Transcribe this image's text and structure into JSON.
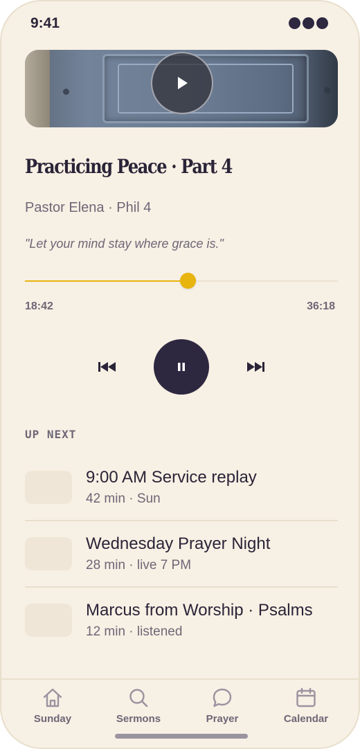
{
  "status_bar": {
    "time": "9:41"
  },
  "now_playing": {
    "title": "Practicing Peace · Part 4",
    "subtitle": "Pastor Elena · Phil 4",
    "quote": "\"Let your mind stay where grace is.\"",
    "elapsed": "18:42",
    "duration": "36:18",
    "progress_fraction": 0.52
  },
  "controls": {
    "prev_icon": "skip-back-icon",
    "pause_icon": "pause-icon",
    "next_icon": "skip-forward-icon"
  },
  "up_next": {
    "label": "UP NEXT",
    "items": [
      {
        "title": "9:00 AM Service replay",
        "meta": "42 min · Sun"
      },
      {
        "title": "Wednesday Prayer Night",
        "meta": "28 min · live 7 PM"
      },
      {
        "title": "Marcus from Worship · Psalms",
        "meta": "12 min · listened"
      }
    ]
  },
  "tabs": [
    {
      "label": "Sunday",
      "icon": "home-icon"
    },
    {
      "label": "Sermons",
      "icon": "search-icon"
    },
    {
      "label": "Prayer",
      "icon": "chat-bubble-icon"
    },
    {
      "label": "Calendar",
      "icon": "calendar-icon"
    }
  ],
  "colors": {
    "accent": "#e8b40e",
    "background": "#f7f0e4",
    "ink": "#2a2438",
    "muted": "#6d6777"
  }
}
